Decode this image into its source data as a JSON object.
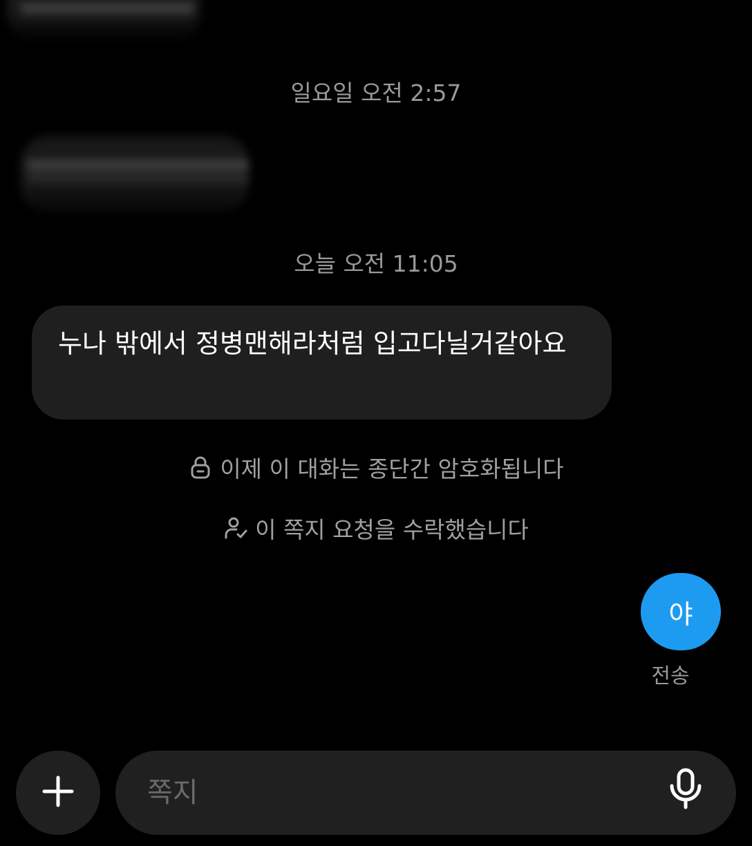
{
  "thread": {
    "timestamps": [
      "일요일 오전 2:57",
      "오늘 오전 11:05"
    ],
    "received_message": "누나 밖에서 정병맨해라처럼 입고다닐거같아요",
    "system_notes": [
      {
        "icon": "lock-icon",
        "text": "이제 이 대화는 종단간 암호화됩니다"
      },
      {
        "icon": "user-check-icon",
        "text": "이 쪽지 요청을 수락했습니다"
      }
    ],
    "sent_message": "야",
    "sent_status": "전송"
  },
  "composer": {
    "placeholder": "쪽지",
    "add_icon": "plus-icon",
    "mic_icon": "microphone-icon"
  },
  "colors": {
    "background": "#000000",
    "received_bubble": "#1f1f1f",
    "sent_bubble": "#1d9bf0",
    "muted_text": "#9a9a9a",
    "composer": "#202020"
  }
}
